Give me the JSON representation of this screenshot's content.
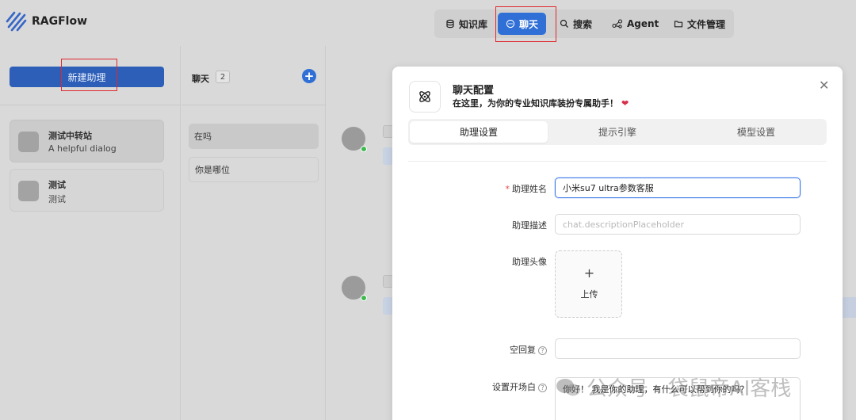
{
  "app": {
    "name": "RAGFlow"
  },
  "nav": {
    "items": [
      {
        "label": "知识库",
        "icon": "database-icon"
      },
      {
        "label": "聊天",
        "icon": "chat-bubble-icon",
        "active": true
      },
      {
        "label": "搜索",
        "icon": "search-icon"
      },
      {
        "label": "Agent",
        "icon": "agent-graph-icon"
      },
      {
        "label": "文件管理",
        "icon": "folder-icon"
      }
    ]
  },
  "sidebar": {
    "new_assistant_label": "新建助理",
    "assistants": [
      {
        "name": "测试中转站",
        "description": "A helpful dialog"
      },
      {
        "name": "测试",
        "description": "测试"
      }
    ]
  },
  "chats": {
    "title": "聊天",
    "count": "2",
    "items": [
      "在吗",
      "你是哪位"
    ]
  },
  "modal": {
    "title": "聊天配置",
    "subtitle": "在这里，为你的专业知识库装扮专属助手！",
    "tabs": [
      "助理设置",
      "提示引擎",
      "模型设置"
    ],
    "form": {
      "name_label": "助理姓名",
      "name_value": "小米su7 ultra参数客服",
      "description_label": "助理描述",
      "description_placeholder": "chat.descriptionPlaceholder",
      "avatar_label": "助理头像",
      "upload_label": "上传",
      "empty_reply_label": "空回复",
      "opener_label": "设置开场白",
      "opener_value": "你好！ 我是你的助理，有什么可以帮到你的吗？"
    }
  },
  "watermark": {
    "text": "公众号 · 袋鼠帝AI客栈"
  },
  "colors": {
    "accent": "#2f6fd6",
    "highlight_box": "#e0282e",
    "required": "#e54848"
  }
}
